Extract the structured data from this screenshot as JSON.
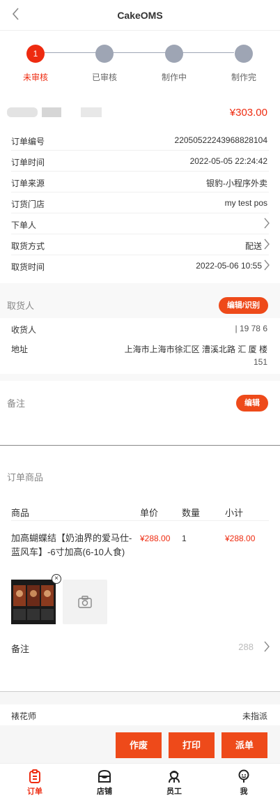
{
  "header": {
    "title": "CakeOMS"
  },
  "steps": [
    {
      "num": "1",
      "label": "未审核",
      "active": true
    },
    {
      "num": "",
      "label": "已审核",
      "active": false
    },
    {
      "num": "",
      "label": "制作中",
      "active": false
    },
    {
      "num": "",
      "label": "制作完",
      "active": false
    }
  ],
  "order": {
    "amount": "¥303.00",
    "rows": [
      {
        "key": "订单编号",
        "value": "220505222439688281​04"
      },
      {
        "key": "订单时间",
        "value": "2022-05-05 22:24:42"
      },
      {
        "key": "订单来源",
        "value": "银豹-小程序外卖"
      },
      {
        "key": "订货门店",
        "value": "my test pos"
      },
      {
        "key": "下单人",
        "value": ""
      },
      {
        "key": "取货方式",
        "value": "配送"
      },
      {
        "key": "取货时间",
        "value": "2022-05-06 10:55"
      }
    ]
  },
  "receiver": {
    "title": "取货人",
    "edit_label": "编辑/识别",
    "name_key": "收货人",
    "name_value": "| 19   78   6",
    "address_key": "地址",
    "address_line1": "上海市上海市徐汇区 漕溪北路  汇  厦  楼",
    "address_line2": "151"
  },
  "remark": {
    "title": "备注",
    "edit_label": "编辑"
  },
  "goods": {
    "title": "订单商品",
    "headers": {
      "name": "商品",
      "price": "单价",
      "qty": "数量",
      "subtotal": "小计"
    },
    "item": {
      "name": "加高蝴蝶结【奶油界的爱马仕-蓝风车】-6寸加高(6-10人食)",
      "price": "¥288.00",
      "qty": "1",
      "subtotal": "¥288.00"
    },
    "remark_key": "备注",
    "remark_value": "288"
  },
  "florist": {
    "key": "裱花师",
    "value": "未指派"
  },
  "actions": {
    "void": "作废",
    "print": "打印",
    "dispatch": "派单"
  },
  "tabs": [
    {
      "label": "订单",
      "icon": "order-icon",
      "active": true
    },
    {
      "label": "店铺",
      "icon": "store-icon",
      "active": false
    },
    {
      "label": "员工",
      "icon": "staff-icon",
      "active": false
    },
    {
      "label": "我",
      "icon": "me-icon",
      "active": false
    }
  ],
  "colors": {
    "accent": "#ee2b10",
    "button": "#ee4a1a",
    "inactive_step": "#9ea5b4"
  }
}
